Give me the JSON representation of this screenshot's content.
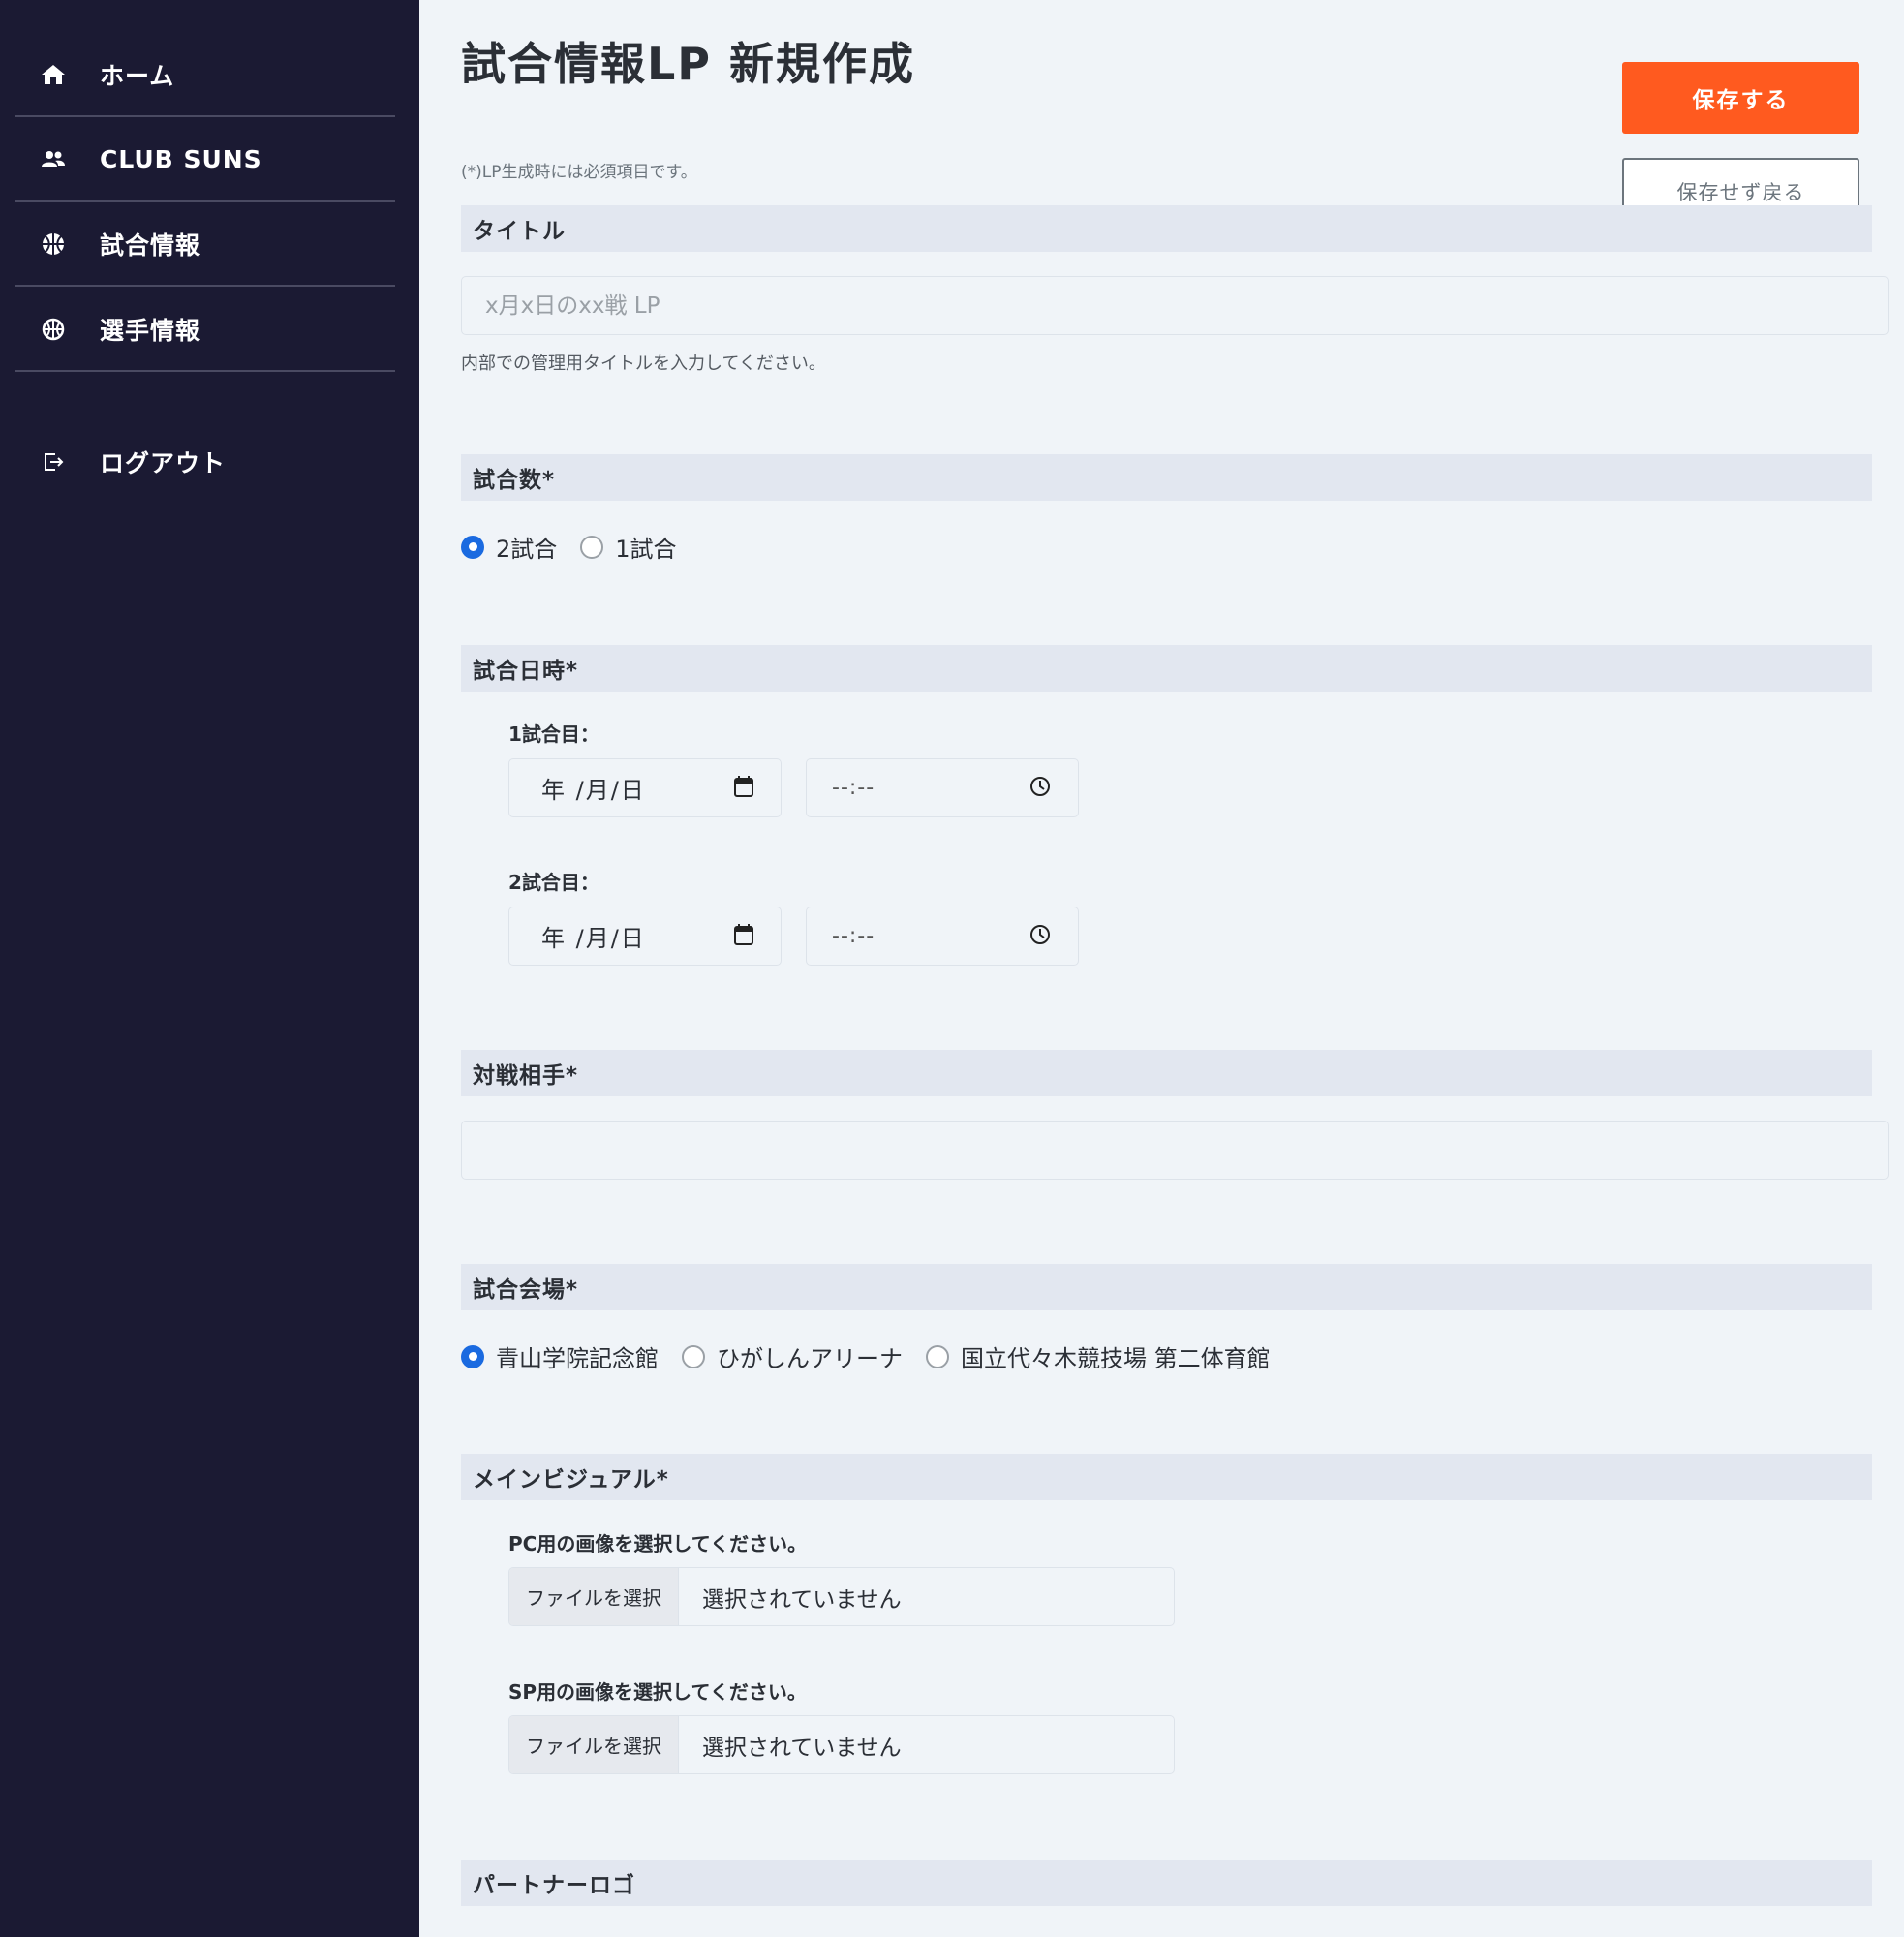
{
  "sidebar": {
    "items": [
      {
        "label": "ホーム",
        "icon": "home-icon"
      },
      {
        "label": "CLUB SUNS",
        "icon": "users-icon"
      },
      {
        "label": "試合情報",
        "icon": "basketball-icon"
      },
      {
        "label": "選手情報",
        "icon": "basketball-icon"
      }
    ],
    "logout": {
      "label": "ログアウト",
      "icon": "logout-icon"
    }
  },
  "page": {
    "title": "試合情報LP 新規作成",
    "required_note": "(*)LP生成時には必須項目です。",
    "save_label": "保存する",
    "back_label": "保存せず戻る"
  },
  "form": {
    "title": {
      "header": "タイトル",
      "placeholder": "x月x日のxx戦 LP",
      "help": "内部での管理用タイトルを入力してください。"
    },
    "games_count": {
      "header": "試合数*",
      "options": [
        "2試合",
        "1試合"
      ],
      "selected": "2試合"
    },
    "schedule": {
      "header": "試合日時*",
      "games": [
        {
          "label": "1試合目：",
          "date": "年 /月/日",
          "time": "--:--"
        },
        {
          "label": "2試合目：",
          "date": "年 /月/日",
          "time": "--:--"
        }
      ]
    },
    "opponent": {
      "header": "対戦相手*",
      "value": ""
    },
    "venue": {
      "header": "試合会場*",
      "options": [
        "青山学院記念館",
        "ひがしんアリーナ",
        "国立代々木競技場 第二体育館"
      ],
      "selected": "青山学院記念館"
    },
    "main_visual": {
      "header": "メインビジュアル*",
      "pc_label": "PC用の画像を選択してください。",
      "sp_label": "SP用の画像を選択してください。",
      "file_button": "ファイルを選択",
      "file_status": "選択されていません"
    },
    "partner_logo": {
      "header": "パートナーロゴ"
    }
  },
  "colors": {
    "sidebar_bg": "#1b1a33",
    "accent": "#ff5a1f",
    "radio_checked": "#1a6ae0"
  }
}
